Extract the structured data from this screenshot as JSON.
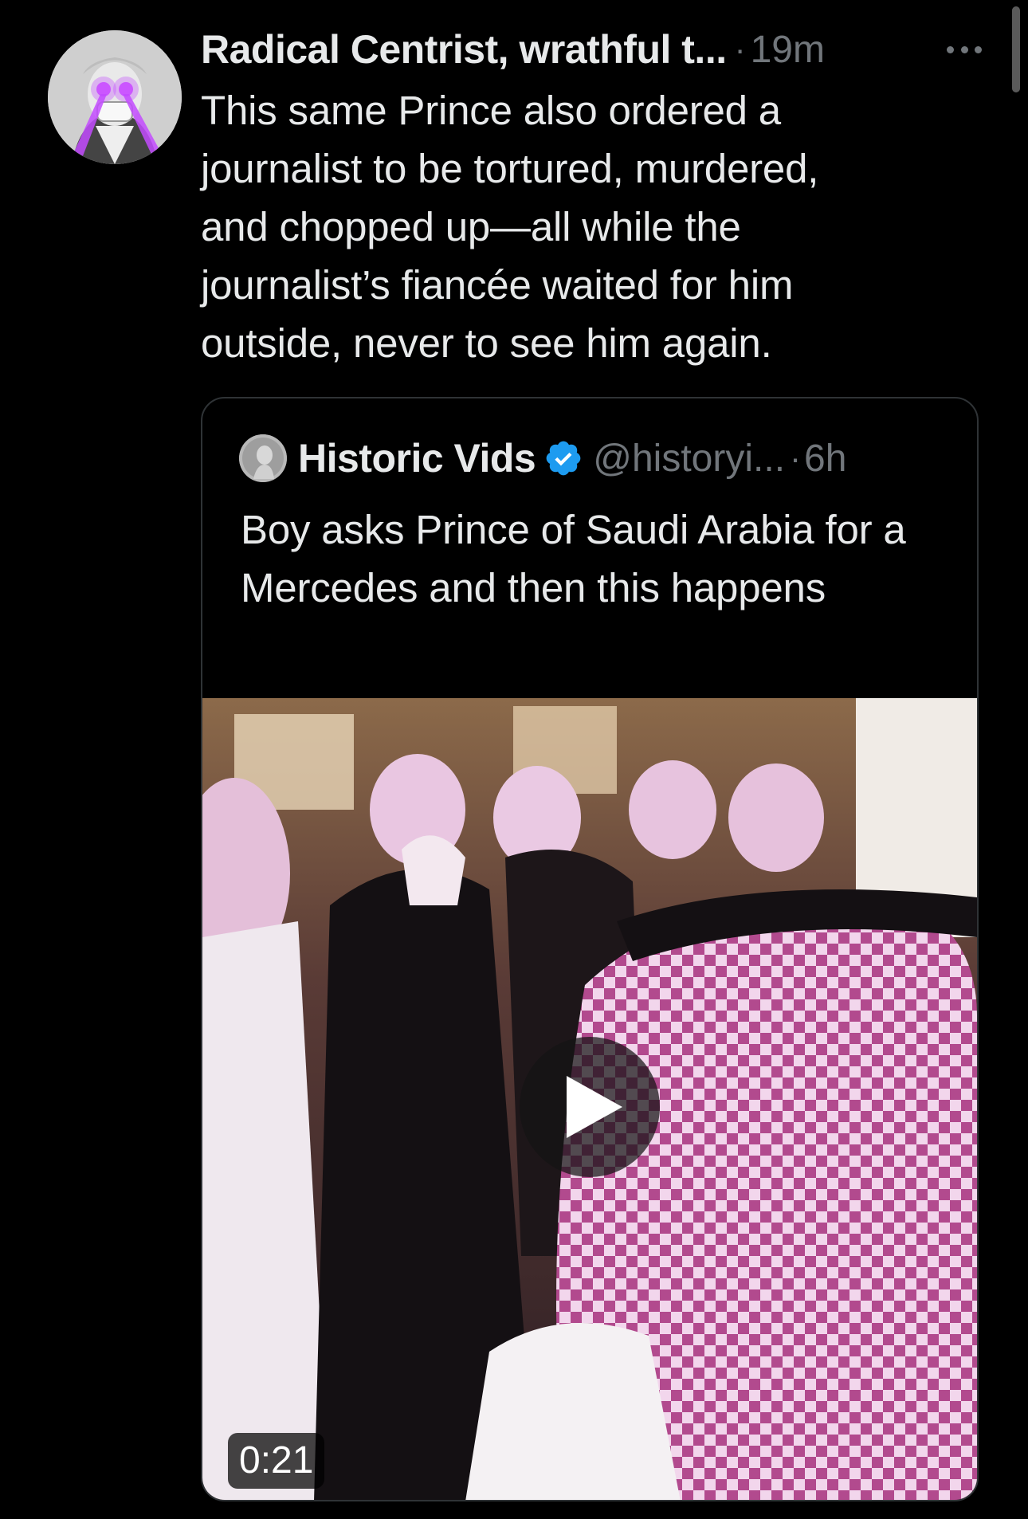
{
  "tweet": {
    "author_name": "Radical Centrist, wrathful t...",
    "separator": "·",
    "timestamp": "19m",
    "text": "This same Prince also ordered a\njournalist to be tortured, murdered,\nand chopped up—all while the\njournalist’s fiancée waited for him\noutside, never to see him again.",
    "more_icon": "more-horizontal-icon",
    "avatar_icon": "avatar-laser-eyes"
  },
  "quote": {
    "author_name": "Historic Vids",
    "verified_icon": "verified-badge-icon",
    "handle": "@historyi...",
    "separator": "·",
    "timestamp": "6h",
    "text": "Boy asks Prince of Saudi Arabia for a Mercedes and then this happens",
    "video": {
      "duration": "0:21",
      "play_icon": "play-icon"
    }
  },
  "colors": {
    "background": "#000000",
    "text_primary": "#e7e9ea",
    "text_secondary": "#71767b",
    "border": "#2f3336",
    "verified_blue": "#1d9bf0",
    "avatar_laser": "#c34bff"
  }
}
